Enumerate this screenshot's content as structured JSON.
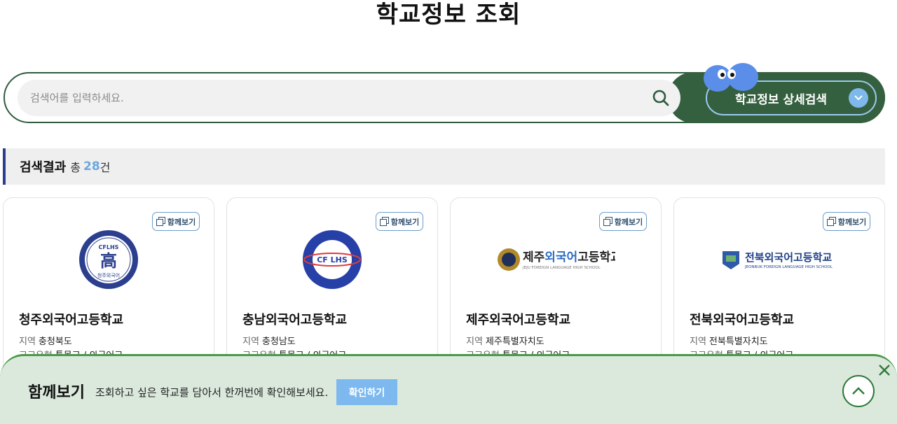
{
  "page": {
    "title": "학교정보 조회"
  },
  "search": {
    "placeholder": "검색어를 입력하세요.",
    "value": "",
    "detail_label": "학교정보 상세검색"
  },
  "results": {
    "title": "검색결과",
    "total_prefix": "총",
    "count": "28",
    "unit": "건"
  },
  "cards": [
    {
      "compare_label": "함께보기",
      "name": "청주외국어고등학교",
      "region_key": "지역",
      "region": "충청북도",
      "type_key": "고교유형",
      "type": "특목고 / 외국어고",
      "logo_text": "CFLHS 高",
      "logo_sub": "청주외국어"
    },
    {
      "compare_label": "함께보기",
      "name": "충남외국어고등학교",
      "region_key": "지역",
      "region": "충청남도",
      "type_key": "고교유형",
      "type": "특목고 / 외국어고",
      "logo_text": "CF LHS",
      "logo_sub": "CHUNGNAM FOREIGN LANGUAGE HIGH SCHOOL"
    },
    {
      "compare_label": "함께보기",
      "name": "제주외국어고등학교",
      "region_key": "지역",
      "region": "제주특별자치도",
      "type_key": "고교유형",
      "type": "특목고 / 외국어고",
      "logo_text": "제주외국어고등학교",
      "logo_sub": "JEJU FOREIGN LANGUAGE HIGH SCHOOL"
    },
    {
      "compare_label": "함께보기",
      "name": "전북외국어고등학교",
      "region_key": "지역",
      "region": "전북특별자치도",
      "type_key": "고교유형",
      "type": "특목고 / 외국어고",
      "logo_text": "전북외국어고등학교",
      "logo_sub": "JEONBUK FOREIGN LANGUAGE HIGH SCHOOL"
    }
  ],
  "compare_panel": {
    "title": "함께보기",
    "description": "조회하고 싶은 학교를 담아서 한꺼번에 확인해보세요.",
    "confirm_label": "확인하기"
  },
  "colors": {
    "brand_green": "#35603f",
    "accent_blue": "#7db9ee",
    "result_bar": "#2c3f8f"
  },
  "icons": [
    "search-icon",
    "chevron-down-icon",
    "copy-icon",
    "close-icon",
    "arrow-up-icon"
  ]
}
